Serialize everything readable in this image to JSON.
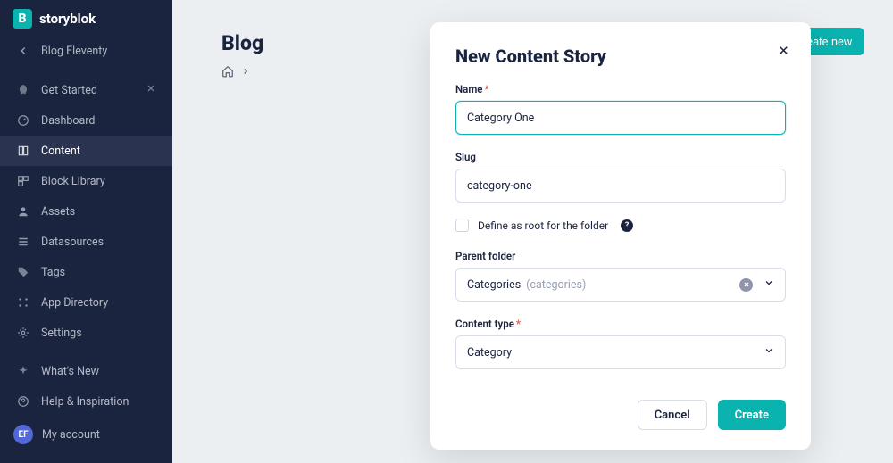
{
  "brand": {
    "name": "storyblok",
    "logo_letter": "B"
  },
  "sidebar": {
    "back_label": "Blog Eleventy",
    "items": [
      {
        "label": "Get Started",
        "closable": true
      },
      {
        "label": "Dashboard"
      },
      {
        "label": "Content",
        "active": true
      },
      {
        "label": "Block Library"
      },
      {
        "label": "Assets"
      },
      {
        "label": "Datasources"
      },
      {
        "label": "Tags"
      },
      {
        "label": "App Directory"
      },
      {
        "label": "Settings"
      }
    ],
    "bottom": [
      {
        "label": "What's New"
      },
      {
        "label": "Help & Inspiration"
      }
    ],
    "account": {
      "initials": "EF",
      "label": "My account"
    }
  },
  "page": {
    "title": "Blog",
    "create_button": "Create new"
  },
  "modal": {
    "title": "New Content Story",
    "name_label": "Name",
    "name_value": "Category One",
    "slug_label": "Slug",
    "slug_value": "category-one",
    "define_root_label": "Define as root for the folder",
    "parent_label": "Parent folder",
    "parent_value": "Categories",
    "parent_slug": "(categories)",
    "content_type_label": "Content type",
    "content_type_value": "Category",
    "cancel": "Cancel",
    "create": "Create"
  }
}
